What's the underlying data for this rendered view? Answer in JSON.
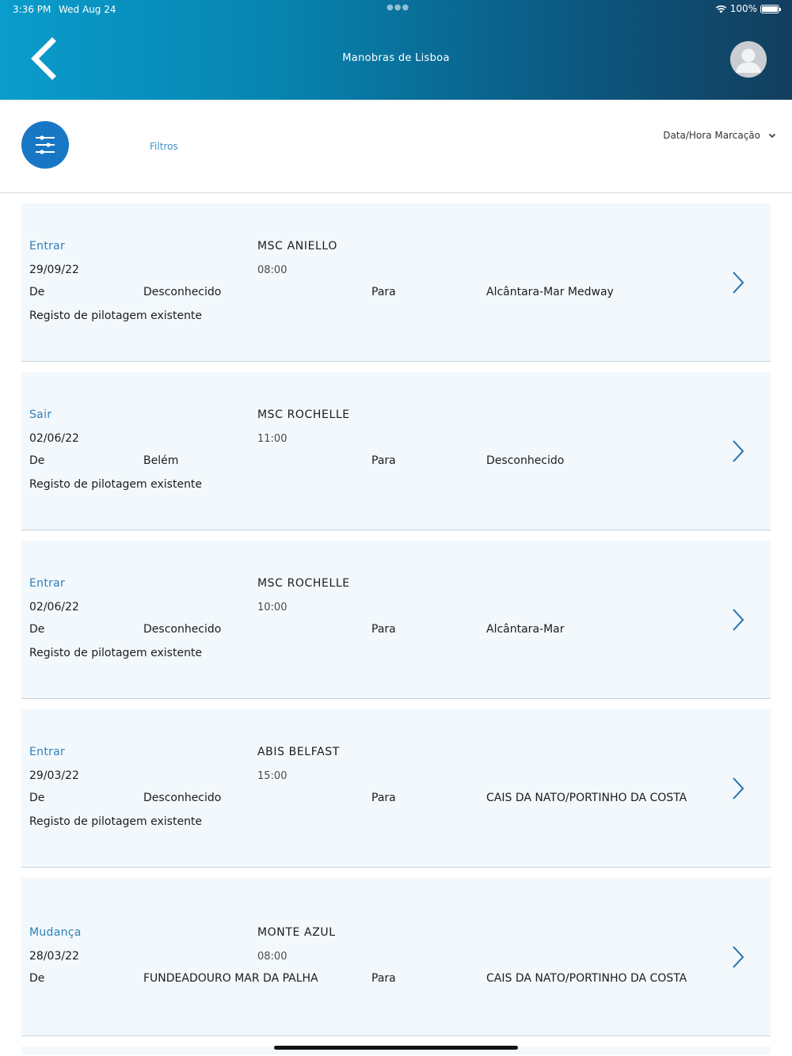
{
  "status_bar": {
    "time": "3:36 PM",
    "date": "Wed Aug 24",
    "battery": "100%",
    "battery_level": 1.0
  },
  "header": {
    "title": "Manobras de Lisboa",
    "back_icon": "chevron-left-icon",
    "avatar_icon": "user-avatar-icon"
  },
  "filters": {
    "label": "Filtros",
    "icon": "sliders-icon",
    "sort_label": "Data/Hora Marcação",
    "sort_icon": "chevron-down-icon"
  },
  "colors": {
    "accent": "#1877c4",
    "type_text": "#2f7fb8",
    "card_bg": "#f2f8fc"
  },
  "manoeuvres": [
    {
      "type": "Entrar",
      "ship": "MSC ANIELLO",
      "date": "29/09/22",
      "time": "08:00",
      "from_label": "De",
      "from": "Desconhecido",
      "to_label": "Para",
      "to": "Alcântara-Mar Medway",
      "note": "Registo de pilotagem existente"
    },
    {
      "type": "Sair",
      "ship": "MSC ROCHELLE",
      "date": "02/06/22",
      "time": "11:00",
      "from_label": "De",
      "from": "Belém",
      "to_label": "Para",
      "to": "Desconhecido",
      "note": "Registo de pilotagem existente"
    },
    {
      "type": "Entrar",
      "ship": "MSC ROCHELLE",
      "date": "02/06/22",
      "time": "10:00",
      "from_label": "De",
      "from": "Desconhecido",
      "to_label": "Para",
      "to": "Alcântara-Mar",
      "note": "Registo de pilotagem existente"
    },
    {
      "type": "Entrar",
      "ship": "ABIS BELFAST",
      "date": "29/03/22",
      "time": "15:00",
      "from_label": "De",
      "from": "Desconhecido",
      "to_label": "Para",
      "to": "CAIS DA NATO/PORTINHO DA COSTA",
      "note": "Registo de pilotagem existente"
    },
    {
      "type": "Mudança",
      "ship": "MONTE AZUL",
      "date": "28/03/22",
      "time": "08:00",
      "from_label": "De",
      "from": "FUNDEADOURO MAR DA PALHA",
      "to_label": "Para",
      "to": "CAIS DA NATO/PORTINHO DA COSTA",
      "note": ""
    }
  ]
}
